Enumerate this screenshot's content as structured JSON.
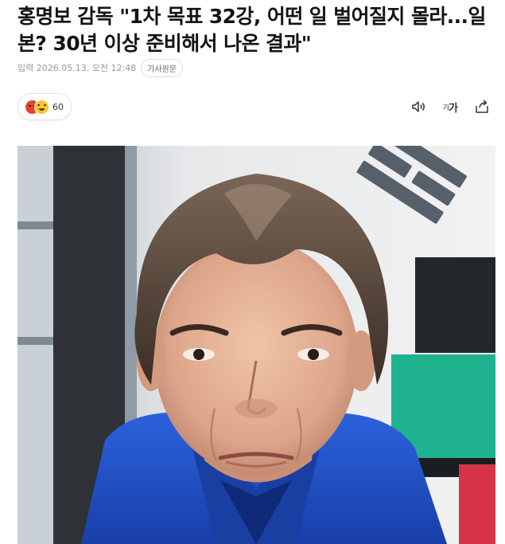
{
  "article": {
    "headline": "홍명보 감독 \"1차 목표 32강, 어떤 일 벌어질지 몰라...일본? 30년 이상 준비해서 나온 결과\"",
    "date": "입력 2026.05.13. 오전 12:48",
    "original_button": "기사원문"
  },
  "reaction": {
    "icons": [
      "angry-emoji-icon",
      "laugh-emoji-icon"
    ],
    "count": "60"
  },
  "toolbar": {
    "icons": [
      "speaker-icon",
      "font-size-icon",
      "share-icon"
    ],
    "font_small": "가",
    "font_large": "가"
  },
  "photo": {
    "subject": "portrait-photo"
  },
  "colors": {
    "angry": "#e2452d",
    "laugh": "#f7c531",
    "jacket_blue": "#1f4fc9",
    "flag_green": "#1fb28f"
  }
}
